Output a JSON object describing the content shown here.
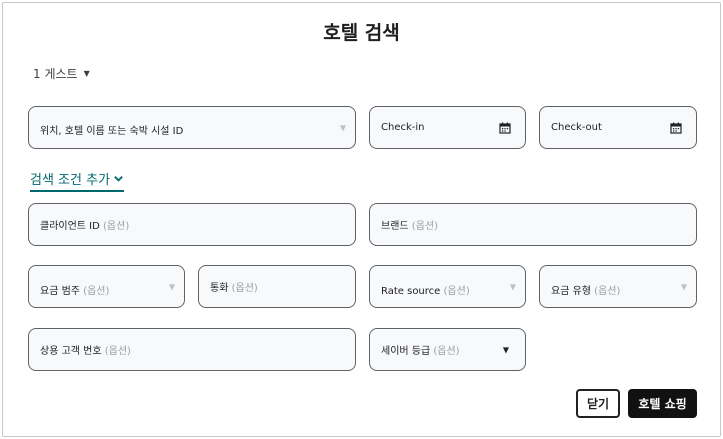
{
  "dialog": {
    "title": "호텔 검색"
  },
  "guests": {
    "label": "1 게스트"
  },
  "location": {
    "placeholder": "위치, 호텔 이름 또는 숙박 시설 ID"
  },
  "checkin": {
    "placeholder": "Check-in"
  },
  "checkout": {
    "placeholder": "Check-out"
  },
  "more_criteria": {
    "label": "검색 조건 추가"
  },
  "optional_suffix": "(옵션)",
  "fields": {
    "client_id": "클라이언트 ID",
    "brand": "브랜드",
    "rate_category": "요금 범주",
    "currency": "통화",
    "rate_source": "Rate source",
    "rate_type": "요금 유형",
    "loyalty_number": "상용 고객 번호",
    "service_tier": "세이버 등급"
  },
  "buttons": {
    "close": "닫기",
    "shop": "호텔 쇼핑"
  },
  "icons": {
    "guests_caret": "caret-down-icon",
    "calendar": "calendar-icon",
    "dropdown": "triangle-down-icon",
    "more_chevron": "chevron-down-icon"
  },
  "colors": {
    "accent": "#00696f",
    "primary_button": "#111111",
    "field_bg": "#f8f9fa",
    "field_border": "#5f6368"
  }
}
